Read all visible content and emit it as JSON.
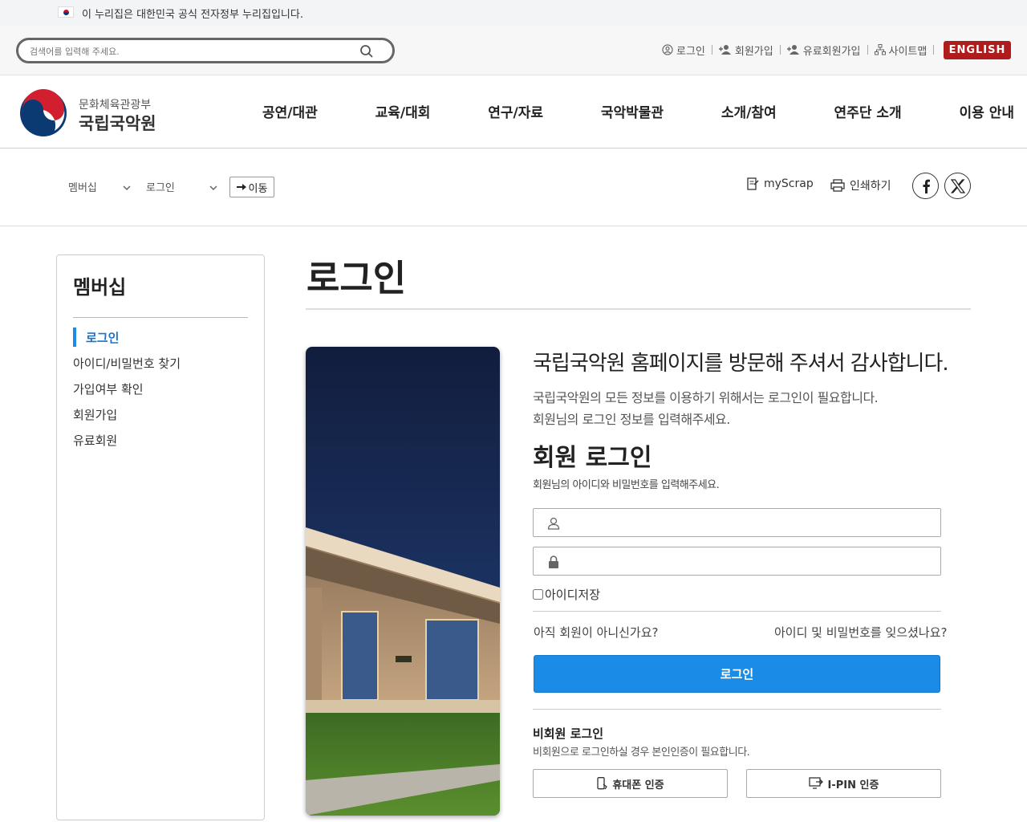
{
  "gov_banner": {
    "text": "이 누리집은 대한민국 공식 전자정부 누리집입니다."
  },
  "search": {
    "placeholder": "검색어를 입력해 주세요."
  },
  "util_links": [
    {
      "label": "로그인",
      "icon": "user-circle-icon"
    },
    {
      "label": "회원가입",
      "icon": "user-add-icon"
    },
    {
      "label": "유료회원가입",
      "icon": "user-add-icon"
    },
    {
      "label": "사이트맵",
      "icon": "sitemap-icon"
    }
  ],
  "english": "ENGLISH",
  "logo": {
    "sub": "문화체육관광부",
    "main": "국립국악원"
  },
  "gnb": [
    "공연/대관",
    "교육/대회",
    "연구/자료",
    "국악박물관",
    "소개/참여",
    "연주단 소개",
    "이용 안내"
  ],
  "location": {
    "crumb1": "멤버십",
    "crumb2": "로그인",
    "go": "이동"
  },
  "tools": {
    "scrap": "myScrap",
    "print": "인쇄하기"
  },
  "sidebar": {
    "title": "멤버십",
    "items": [
      "로그인",
      "아이디/비밀번호 찾기",
      "가입여부 확인",
      "회원가입",
      "유료회원"
    ]
  },
  "main": {
    "title": "로그인",
    "welcome": "국립국악원 홈페이지를 방문해 주셔서 감사합니다.",
    "intro1": "국립국악원의 모든 정보를 이용하기 위해서는 로그인이 필요합니다.",
    "intro2": "회원님의 로그인 정보를 입력해주세요.",
    "login_heading": "회원 로그인",
    "login_sub": "회원님의 아이디와 비밀번호를 입력해주세요.",
    "save_id": "아이디저장",
    "not_member": "아직 회원이 아니신가요?",
    "forgot": "아이디 및 비밀번호를 잊으셨나요?",
    "login_button": "로그인",
    "guest_title": "비회원 로그인",
    "guest_sub": "비회원으로 로그인하실 경우 본인인증이 필요합니다.",
    "phone_cert": "휴대폰 인증",
    "ipin_cert": "I-PIN 인증"
  },
  "colors": {
    "accent": "#1a8be6",
    "english_bg": "#b01c1c",
    "active_menu": "#1a73c9"
  }
}
